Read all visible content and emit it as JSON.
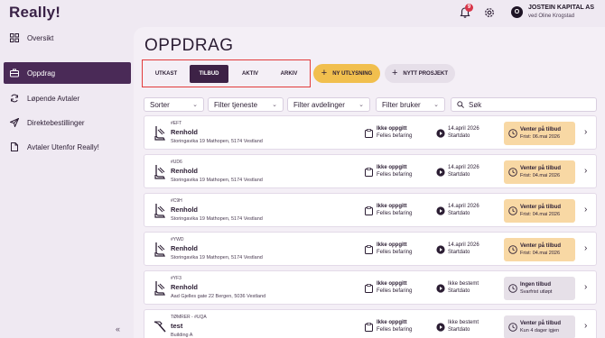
{
  "app": {
    "logo": "Really!"
  },
  "header": {
    "notification_count": "9",
    "avatar_letter": "O",
    "company": "JOSTEIN KAPITAL AS",
    "user_line": "ved Oline Krogstad"
  },
  "sidebar": {
    "items": [
      {
        "label": "Oversikt",
        "icon": "grid-icon"
      },
      {
        "label": "Oppdrag",
        "icon": "briefcase-icon"
      },
      {
        "label": "Løpende Avtaler",
        "icon": "refresh-icon"
      },
      {
        "label": "Direktebestillinger",
        "icon": "send-icon"
      },
      {
        "label": "Avtaler Utenfor Really!",
        "icon": "document-icon"
      }
    ],
    "collapse_label": "«"
  },
  "main": {
    "title": "OPPDRAG",
    "tabs": [
      "UTKAST",
      "TILBUD",
      "AKTIV",
      "ARKIV"
    ],
    "active_tab": "TILBUD",
    "actions": {
      "new_tender": "NY UTLYSNING",
      "new_project": "NYTT PROSJEKT"
    },
    "filters": [
      "Sorter",
      "Filter tjeneste",
      "Filter avdelinger",
      "Filter bruker"
    ],
    "search_placeholder": "Søk"
  },
  "rows": [
    {
      "code": "#EFT",
      "service": "Renhold",
      "address": "Storingavika 19 Mathopen, 5174 Vestland",
      "price": "Ikke oppgitt",
      "price_sub": "Felles befaring",
      "date": "14.april 2026",
      "date_sub": "Startdato",
      "status": "Venter på tilbud",
      "status_sub": "Frist: 06.mai 2026",
      "status_color": "orange",
      "icon": "vacuum-icon"
    },
    {
      "code": "#UD6",
      "service": "Renhold",
      "address": "Storingavika 19 Mathopen, 5174 Vestland",
      "price": "Ikke oppgitt",
      "price_sub": "Felles befaring",
      "date": "14.april 2026",
      "date_sub": "Startdato",
      "status": "Venter på tilbud",
      "status_sub": "Frist: 04.mai 2026",
      "status_color": "orange",
      "icon": "vacuum-icon"
    },
    {
      "code": "#C9H",
      "service": "Renhold",
      "address": "Storingavika 19 Mathopen, 5174 Vestland",
      "price": "Ikke oppgitt",
      "price_sub": "Felles befaring",
      "date": "14.april 2026",
      "date_sub": "Startdato",
      "status": "Venter på tilbud",
      "status_sub": "Frist: 04.mai 2026",
      "status_color": "orange",
      "icon": "vacuum-icon"
    },
    {
      "code": "#YWD",
      "service": "Renhold",
      "address": "Storingavika 19 Mathopen, 5174 Vestland",
      "price": "Ikke oppgitt",
      "price_sub": "Felles befaring",
      "date": "14.april 2026",
      "date_sub": "Startdato",
      "status": "Venter på tilbud",
      "status_sub": "Frist: 04.mai 2026",
      "status_color": "orange",
      "icon": "vacuum-icon"
    },
    {
      "code": "#YF3",
      "service": "Renhold",
      "address": "Aad Gjelles gate 22 Bergen, 5036 Vestland",
      "price": "Ikke oppgitt",
      "price_sub": "Felles befaring",
      "date": "Ikke bestemt",
      "date_sub": "Startdato",
      "status": "Ingen tilbud",
      "status_sub": "Svarfrist utløpt",
      "status_color": "gray",
      "icon": "vacuum-icon"
    },
    {
      "code": "TØMRER - #UQA",
      "service": "test",
      "address": "Building A",
      "price": "Ikke oppgitt",
      "price_sub": "Felles befaring",
      "date": "Ikke bestemt",
      "date_sub": "Startdato",
      "status": "Venter på tilbud",
      "status_sub": "Kun 4 dager igjen",
      "status_color": "gray",
      "icon": "hammer-icon"
    }
  ],
  "colors": {
    "accent": "#4a2a57",
    "yellow": "#f1bf4e",
    "status_orange": "#f8d8a4",
    "highlight_red": "#e23b3b"
  }
}
